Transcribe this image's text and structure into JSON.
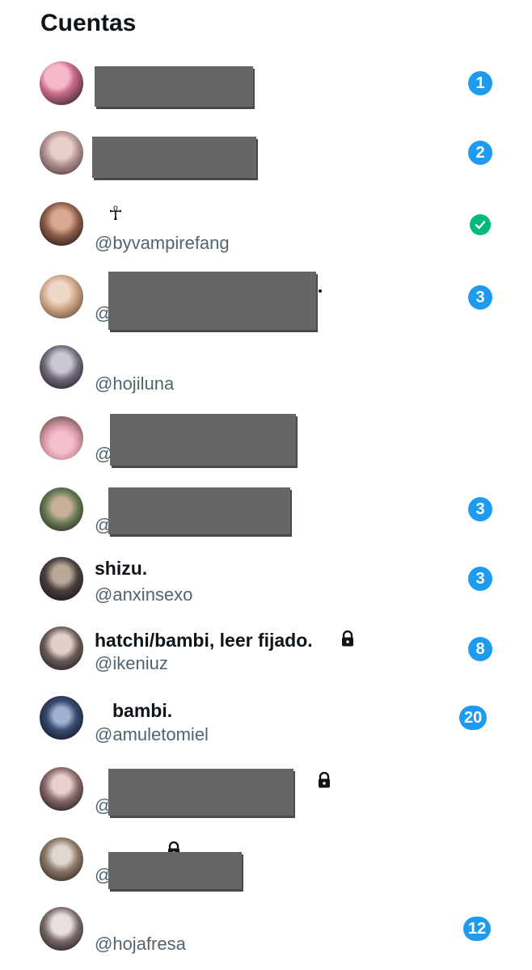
{
  "header": {
    "title": "Cuentas"
  },
  "accounts": [
    {
      "badge": "1"
    },
    {
      "badge": "2"
    },
    {
      "name_symbol": "☥",
      "handle": "@byvampirefang",
      "status": "check"
    },
    {
      "handle_prefix": "@",
      "badge": "3"
    },
    {
      "handle": "@hojiluna"
    },
    {
      "handle_prefix": "@"
    },
    {
      "handle_prefix": "@",
      "badge": "3"
    },
    {
      "name": "shizu.",
      "handle": "@anxinsexo",
      "badge": "3"
    },
    {
      "name": "hatchi/bambi, leer fijado.",
      "handle": "@ikeniuz",
      "badge": "8",
      "locked": true
    },
    {
      "name": "bambi.",
      "handle": "@amuletomiel",
      "badge": "20"
    },
    {
      "handle_prefix": "@",
      "locked": true
    },
    {
      "handle_prefix": "@",
      "locked": true
    },
    {
      "handle": "@hojafresa",
      "badge": "12"
    }
  ],
  "colors": {
    "badge": "#1d9bf0",
    "verified": "#00ba7c",
    "handle": "#536471",
    "redaction": "#666666"
  },
  "icons": {
    "lock": "lock-icon",
    "check": "check-icon"
  }
}
